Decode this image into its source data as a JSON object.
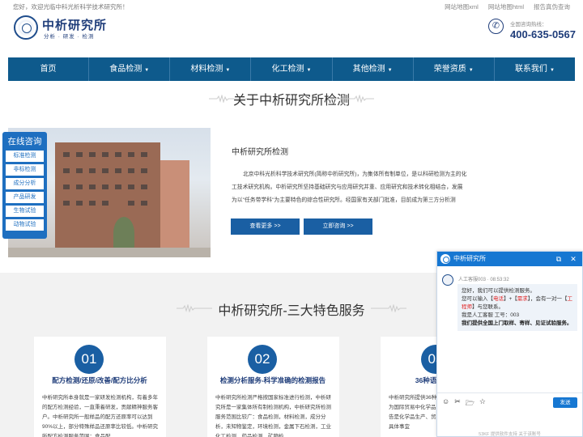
{
  "topbar": {
    "welcome": "您好，欢迎光临中科光析科学技术研究所！",
    "links": [
      "网站地图xml",
      "网站地图html",
      "报告真伪查询"
    ]
  },
  "header": {
    "brand_name": "中析研究所",
    "brand_tagline": "分析 · 研发 · 检测",
    "hotline_label": "全国咨询热线：",
    "hotline_number": "400-635-0567"
  },
  "nav": {
    "items": [
      {
        "label": "首页",
        "dropdown": false
      },
      {
        "label": "食品检测",
        "dropdown": true
      },
      {
        "label": "材料检测",
        "dropdown": true
      },
      {
        "label": "化工检测",
        "dropdown": true
      },
      {
        "label": "其他检测",
        "dropdown": true
      },
      {
        "label": "荣誉资质",
        "dropdown": true
      },
      {
        "label": "联系我们",
        "dropdown": true
      }
    ]
  },
  "about": {
    "title": "关于中析研究所检测",
    "heading": "中析研究所检测",
    "paragraph": "北京中科光析科学技术研究所(简称中析研究所)，为集体所有制单位，是以科研检测为主的化工技术研究机构。中析研究所坚持基础研究与应用研究并重、应用研究和技术转化相结合，发展为以\"任务带学科\"为主要特色的综合性研究所。经国家有关部门批准，目前成为第三方分析测",
    "btn_more": "查看更多 >>",
    "btn_consult": "立即咨询 >>"
  },
  "side_consult": {
    "title": "在线咨询",
    "items": [
      "标准检测",
      "非标检测",
      "成分分析",
      "产品研发",
      "生物试验",
      "动物试验"
    ]
  },
  "services": {
    "title": "中析研究所-三大特色服务",
    "cards": [
      {
        "num": "01",
        "title": "配方检测/还原/改善/配方比分析",
        "body": "中析研究所本身就是一家研发检测机构，有着多年的配方检测经验，一直秉着研发，贡献精神服务客户。中析研究所一般样品的配方还原率可以达到90%以上，部分特殊样品还原率比较低。中析研究所配方检测服务范围：食品配"
      },
      {
        "num": "02",
        "title": "检测分析服务-科学准确的检测报告",
        "body": "中析研究所检测严格按国家标准进行检测，中析研究所是一家集体所有制检测机构，中析研究所检测服务范围比较广：食品检测，材料检测，成分分析，未知物鉴定，环境检测，金属下石检测，工业化工检测，药品检测，矿物检"
      },
      {
        "num": "03",
        "title": "36种语言MSDS报告",
        "body": "中析研究所提供36种语言MSDS编写服务，告编写为国际贸易中化学品的安全数据表，编写MSDS报告是化学品生产、贸易、运输中的必备文件。品，具体事宜"
      }
    ]
  },
  "chat": {
    "title": "中析研究所",
    "agent_meta": "人工客服003 · 08:53:32",
    "msg_greeting": "您好，我们可以提供检测服务。",
    "msg_line2_a": "您可以输入【",
    "msg_line2_b": "电话",
    "msg_line2_c": "】+【",
    "msg_line2_d": "需求",
    "msg_line2_e": "】，会有一对一【",
    "msg_line2_f": "工程师",
    "msg_line2_g": "】与您联系。",
    "msg_line3": "我是人工客服  工号：003",
    "msg_line4": "我们提供全国上门取样、寄样、见证试验服务。",
    "send_label": "发送",
    "footer": "53KF 提供软件支持   关于该账号"
  },
  "colors": {
    "nav_bg": "#0e5a8c",
    "brand_blue": "#1f3d7a",
    "button_blue": "#1a5fa3",
    "chat_blue": "#1677d2",
    "highlight_red": "#e02020"
  }
}
